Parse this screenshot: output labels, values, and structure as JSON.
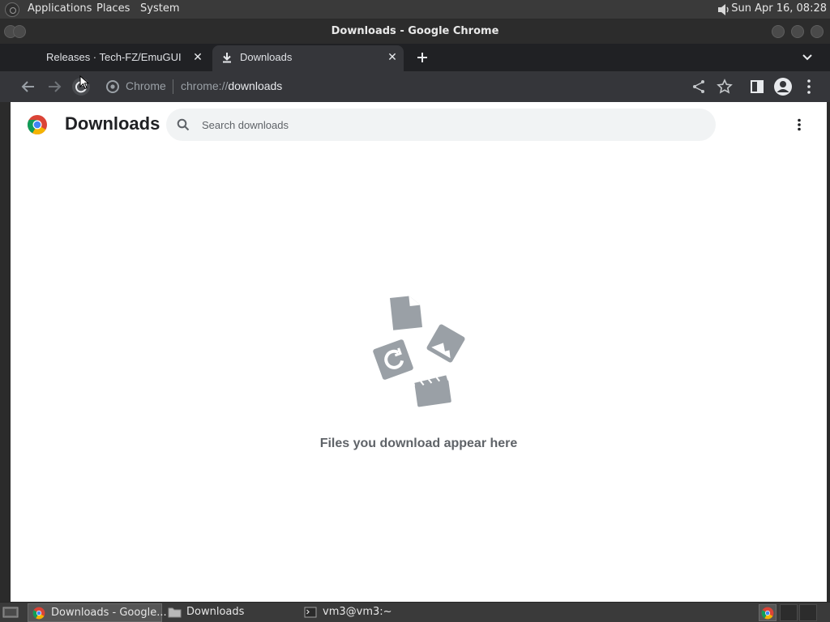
{
  "top_panel": {
    "menus": [
      "Applications",
      "Places",
      "System"
    ],
    "clock": "Sun Apr 16, 08:28"
  },
  "window": {
    "title": "Downloads - Google Chrome"
  },
  "tabs": [
    {
      "label": "Releases · Tech-FZ/EmuGUI",
      "active": false
    },
    {
      "label": "Downloads",
      "active": true
    }
  ],
  "toolbar": {
    "omnibox_origin": "Chrome",
    "url_scheme": "chrome://",
    "url_path": "downloads"
  },
  "page": {
    "title": "Downloads",
    "search_placeholder": "Search downloads",
    "empty_message": "Files you download appear here"
  },
  "taskbar": {
    "items": [
      {
        "label": "Downloads - Google...",
        "icon": "chrome-icon",
        "active": true
      },
      {
        "label": "Downloads",
        "icon": "folder-icon",
        "active": false
      },
      {
        "label": "vm3@vm3:~",
        "icon": "terminal-icon",
        "active": false
      }
    ]
  },
  "colors": {
    "panel_bg": "#3a3a3a",
    "tab_strip_bg": "#202124",
    "toolbar_bg": "#35363a",
    "page_bg": "#ffffff",
    "illustration_gray": "#9aa0a6"
  }
}
